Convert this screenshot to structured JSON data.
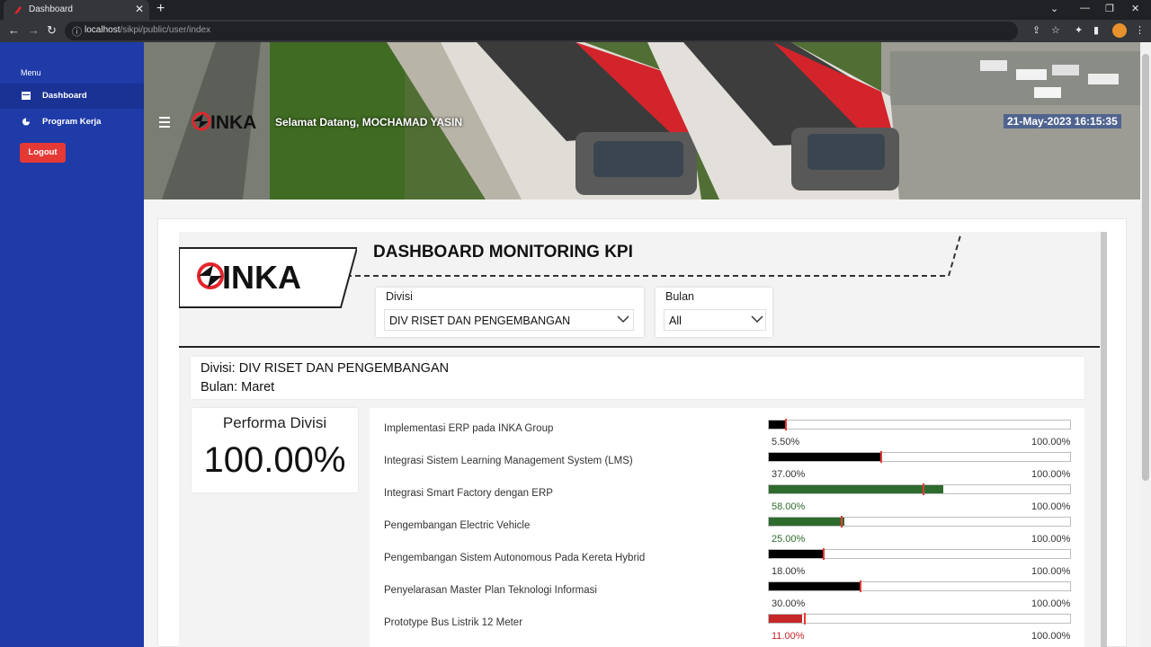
{
  "browser": {
    "tab_title": "Dashboard",
    "url_host": "localhost",
    "url_path": "/sikpi/public/user/index"
  },
  "sidebar": {
    "menu_heading": "Menu",
    "items": [
      {
        "label": "Dashboard",
        "icon": "dashboard-icon",
        "active": true
      },
      {
        "label": "Program Kerja",
        "icon": "pie-chart-icon",
        "active": false
      }
    ],
    "logout_label": "Logout"
  },
  "header": {
    "logo_text": "INKA",
    "welcome": "Selamat Datang, MOCHAMAD YASIN",
    "datetime": "21-May-2023  16:15:35"
  },
  "report": {
    "logo_text": "INKA",
    "title": "DASHBOARD MONITORING KPI",
    "filters": {
      "divisi_label": "Divisi",
      "divisi_value": "DIV RISET DAN PENGEMBANGAN",
      "bulan_label": "Bulan",
      "bulan_value": "All"
    },
    "info": {
      "divisi_line": "Divisi: DIV RISET DAN PENGEMBANGAN",
      "bulan_line": "Bulan: Maret"
    },
    "performance": {
      "title": "Performa Divisi",
      "value": "100.00%"
    },
    "kpis": [
      {
        "name": "Implementasi ERP pada INKA Group",
        "value_label": "5.50%",
        "max_label": "100.00%",
        "fill": 0.055,
        "target": 0.055,
        "color": "#000000",
        "value_color": "#333333"
      },
      {
        "name": "Integrasi Sistem Learning Management System (LMS)",
        "value_label": "37.00%",
        "max_label": "100.00%",
        "fill": 0.37,
        "target": 0.37,
        "color": "#000000",
        "value_color": "#333333"
      },
      {
        "name": "Integrasi Smart Factory dengan ERP",
        "value_label": "58.00%",
        "max_label": "100.00%",
        "fill": 0.58,
        "target": 0.51,
        "color": "#2e6b2e",
        "value_color": "#2e6b2e"
      },
      {
        "name": "Pengembangan Electric Vehicle",
        "value_label": "25.00%",
        "max_label": "100.00%",
        "fill": 0.25,
        "target": 0.24,
        "color": "#2e6b2e",
        "value_color": "#2e6b2e"
      },
      {
        "name": "Pengembangan Sistem Autonomous Pada Kereta Hybrid",
        "value_label": "18.00%",
        "max_label": "100.00%",
        "fill": 0.18,
        "target": 0.18,
        "color": "#000000",
        "value_color": "#333333"
      },
      {
        "name": "Penyelarasan Master Plan Teknologi Informasi",
        "value_label": "30.00%",
        "max_label": "100.00%",
        "fill": 0.3,
        "target": 0.3,
        "color": "#000000",
        "value_color": "#333333"
      },
      {
        "name": "Prototype Bus Listrik 12 Meter",
        "value_label": "11.00%",
        "max_label": "100.00%",
        "fill": 0.11,
        "target": 0.115,
        "color": "#c62828",
        "value_color": "#c62828"
      }
    ]
  },
  "colors": {
    "sidebar": "#1f3ba8",
    "logout": "#e53935",
    "brand_red": "#e4252b"
  }
}
